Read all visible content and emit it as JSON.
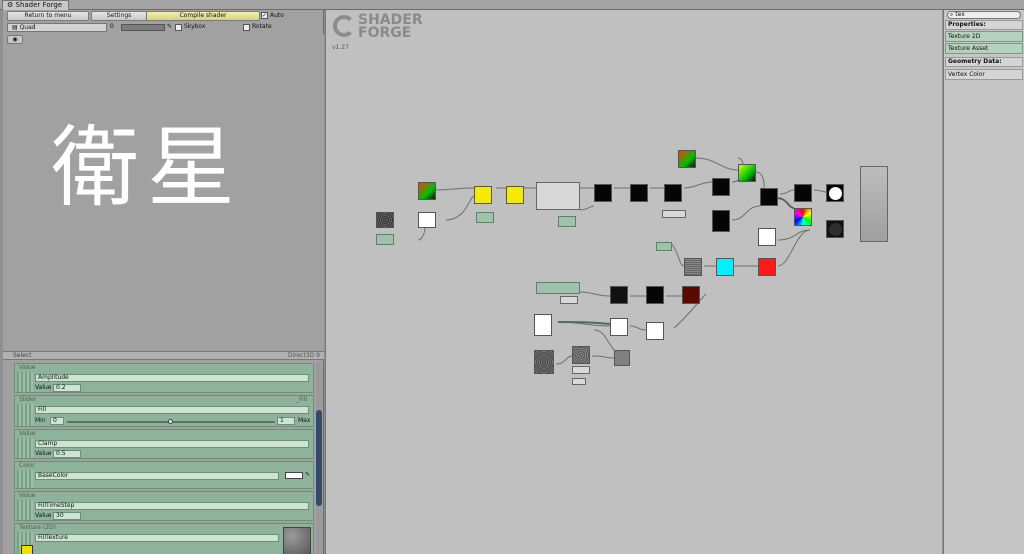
{
  "window": {
    "tab_title": "Shader Forge"
  },
  "toolbar": {
    "return_label": "Return to menu",
    "settings_label": "Settings",
    "compile_label": "Compile shader",
    "auto_label": "Auto",
    "auto_checked": "✓"
  },
  "preview": {
    "mesh_label": "Quad",
    "mesh_value_label": "0",
    "skybox_label": "Skybox",
    "rotate_label": "Rotate",
    "overlay_text": "衛星"
  },
  "properties_header": {
    "select_label": "Select",
    "api_label": "Direct3D 9"
  },
  "properties": [
    {
      "category": "Value",
      "name": "Amplitude",
      "value_label": "Value",
      "value": "0.2"
    },
    {
      "category": "Slider",
      "category_right": "_Fill",
      "name": "Fill",
      "min_label": "Min",
      "min": "0",
      "max": "1",
      "max_label": "Max",
      "level": 0.5
    },
    {
      "category": "Value",
      "name": "Clamp",
      "value_label": "Value",
      "value": "0.5"
    },
    {
      "category": "Color",
      "name": "BaseColor",
      "color": "#ffffff"
    },
    {
      "category": "Value",
      "name": "FillTimeStep",
      "value_label": "Value",
      "value": "30"
    },
    {
      "category": "Texture (2D)",
      "name": "FillTexture"
    }
  ],
  "canvas": {
    "logo_line1": "SHADER",
    "logo_line2": "FORGE",
    "version": "v1.27"
  },
  "right_panel": {
    "search_value": "tex",
    "properties_header": "Properties:",
    "property_items": [
      "Texture 2D",
      "Texture Asset"
    ],
    "geometry_header": "Geometry Data:",
    "geometry_items": [
      "Vertex Color"
    ]
  },
  "colors": {
    "accent_green": "#8eb39b",
    "compile_yellow": "#d8d27c",
    "node_yellow": "#f5ea00",
    "node_cyan": "#00f0ff",
    "node_red": "#ff1a1a",
    "scroll_blue": "#2e4b6e"
  }
}
